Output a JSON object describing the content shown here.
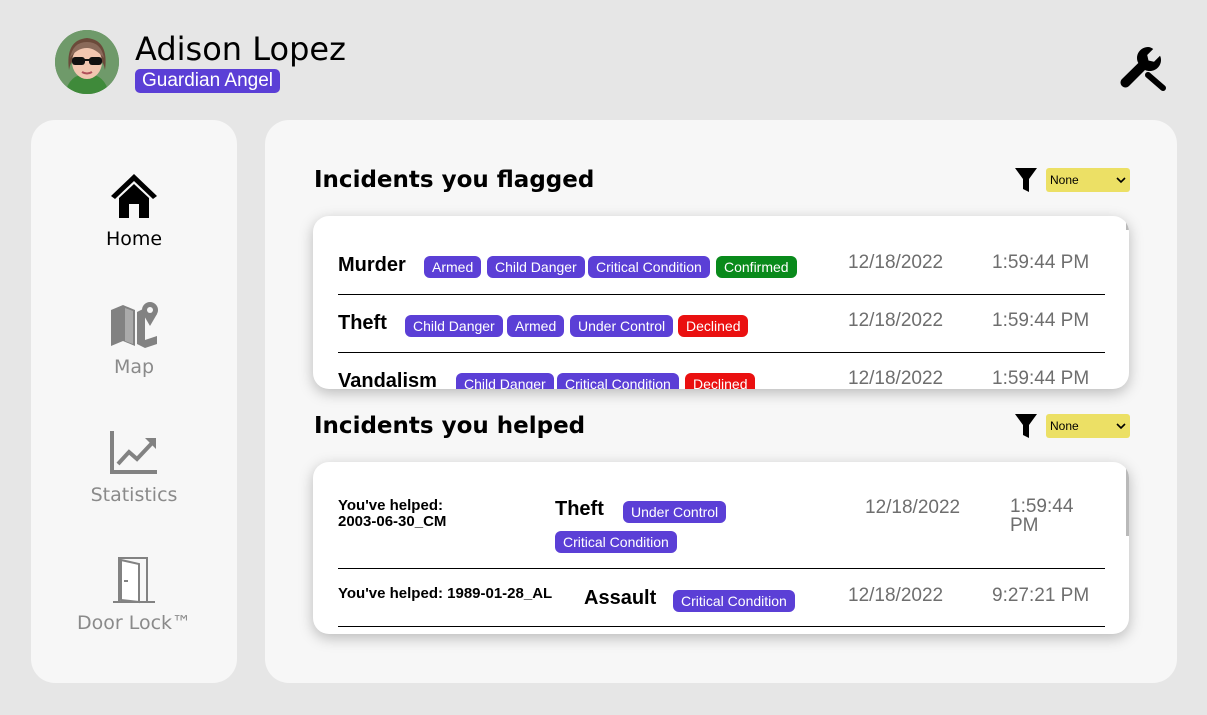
{
  "user": {
    "name": "Adison Lopez",
    "role": "Guardian Angel",
    "avatar_icon": "avatar-icon"
  },
  "toolbar": {
    "settings_icon": "wrench-icon"
  },
  "sidebar": {
    "items": [
      {
        "label": "Home",
        "icon": "home-icon",
        "active": true
      },
      {
        "label": "Map",
        "icon": "map-icon",
        "active": false
      },
      {
        "label": "Statistics",
        "icon": "chart-line-icon",
        "active": false
      },
      {
        "label": "Door Lock™",
        "icon": "door-icon",
        "active": false
      }
    ]
  },
  "flagged": {
    "title": "Incidents you flagged",
    "filter_value": "None",
    "rows": [
      {
        "type": "Murder",
        "tags": [
          "Armed",
          "Child Danger",
          "Critical Condition",
          "Confirmed"
        ],
        "date": "12/18/2022",
        "time": "1:59:44 PM"
      },
      {
        "type": "Theft",
        "tags": [
          "Child Danger",
          "Armed",
          "Under Control",
          "Declined"
        ],
        "date": "12/18/2022",
        "time": "1:59:44 PM"
      },
      {
        "type": "Vandalism",
        "tags": [
          "Child Danger",
          "Critical Condition",
          "Declined"
        ],
        "date": "12/18/2022",
        "time": "1:59:44 PM"
      }
    ]
  },
  "helped": {
    "title": "Incidents you helped",
    "filter_value": "None",
    "rows": [
      {
        "helped_label": "You've helped: 2003-06-30_CM",
        "helped_line1": "You've helped:",
        "helped_line2": "2003-06-30_CM",
        "type": "Theft",
        "tags": [
          "Under Control",
          "Critical Condition"
        ],
        "date": "12/18/2022",
        "time_line1": "1:59:44",
        "time_line2": "PM"
      },
      {
        "helped_label": "You've helped: 1989-01-28_AL",
        "type": "Assault",
        "tags": [
          "Critical Condition"
        ],
        "date": "12/18/2022",
        "time": "9:27:21 PM"
      }
    ]
  },
  "colors": {
    "accent": "#5b3fd6",
    "confirmed": "#098a1b",
    "declined": "#ea1010",
    "filter": "#ece065"
  }
}
